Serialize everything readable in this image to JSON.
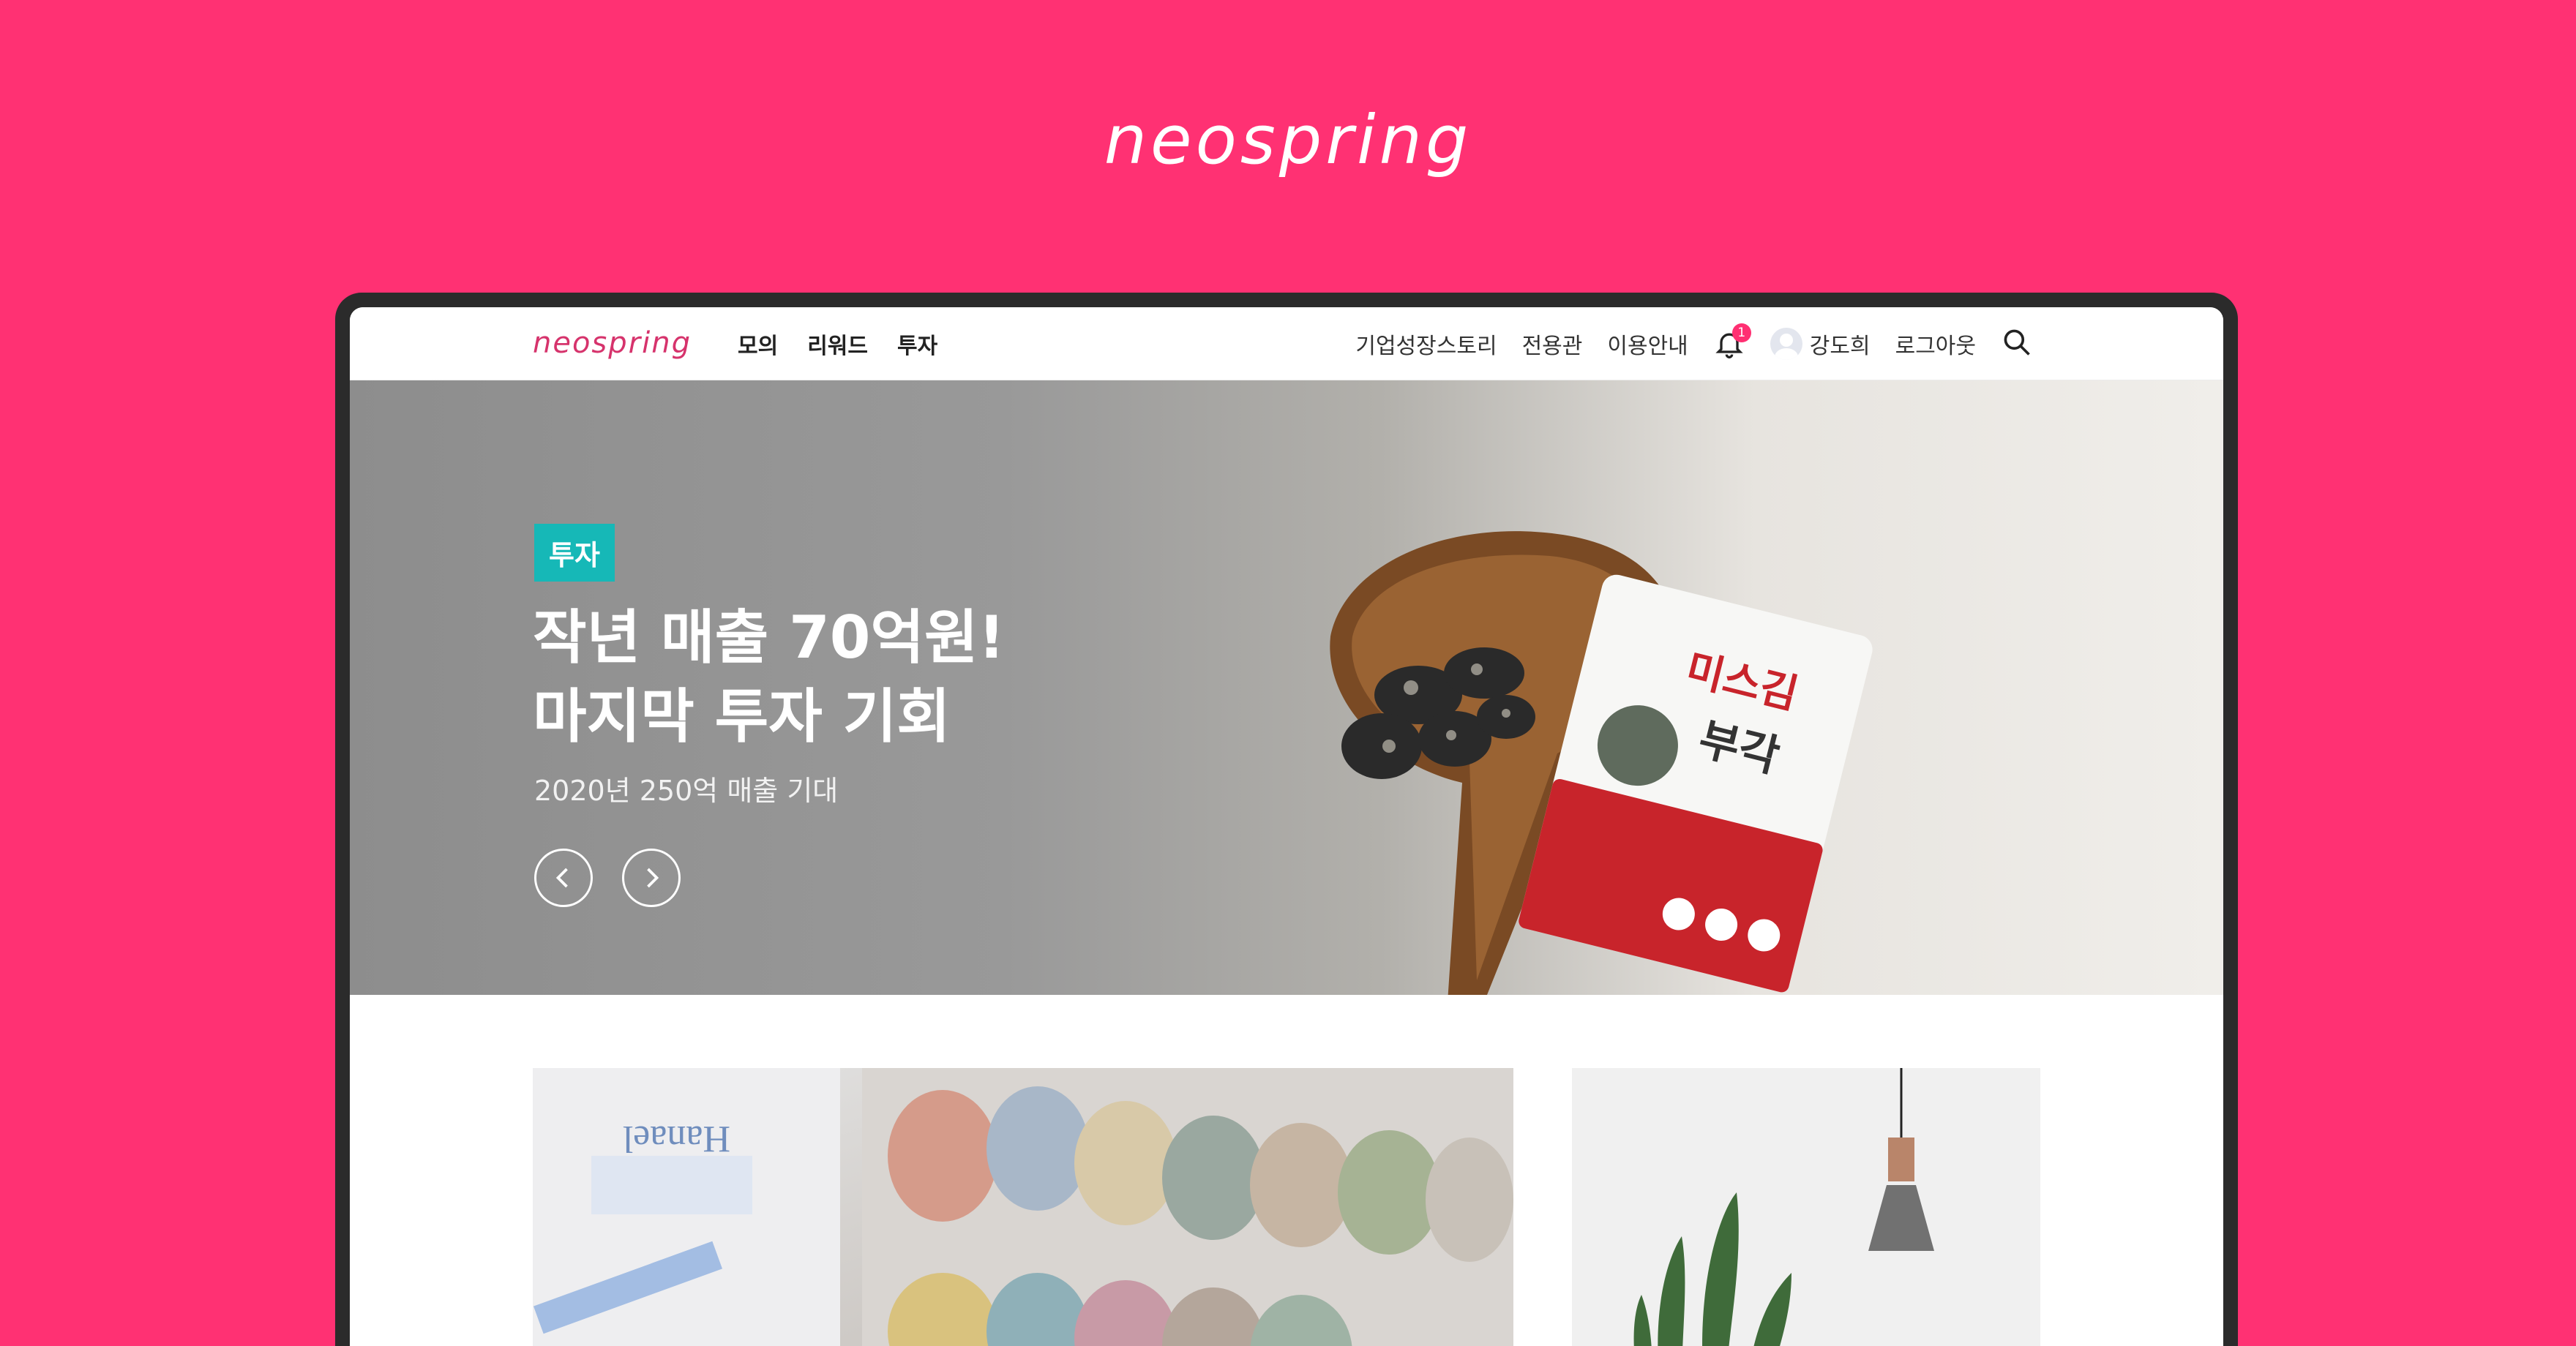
{
  "brand": {
    "logo_text": "neospring"
  },
  "nav": {
    "logo_text": "neospring",
    "menu": [
      "모의",
      "리워드",
      "투자"
    ],
    "links": [
      "기업성장스토리",
      "전용관",
      "이용안내"
    ],
    "notification_count": "1",
    "user_name": "강도희",
    "logout_label": "로그아웃",
    "icons": {
      "bell": "bell-icon",
      "avatar": "avatar-icon",
      "search": "search-icon"
    }
  },
  "hero": {
    "tag": "투자",
    "title_line1": "작년 매출 70억원!",
    "title_line2": "마지막 투자 기회",
    "subtitle": "2020년 250억 매출 기대",
    "packet_title": "미스김",
    "packet_subtitle": "부각"
  },
  "cards": {
    "left_box_text": "Hanael"
  },
  "colors": {
    "background": "#ff3173",
    "accent_pink": "#d6336c",
    "tag_teal": "#16b8b7",
    "badge": "#ff2f72"
  }
}
